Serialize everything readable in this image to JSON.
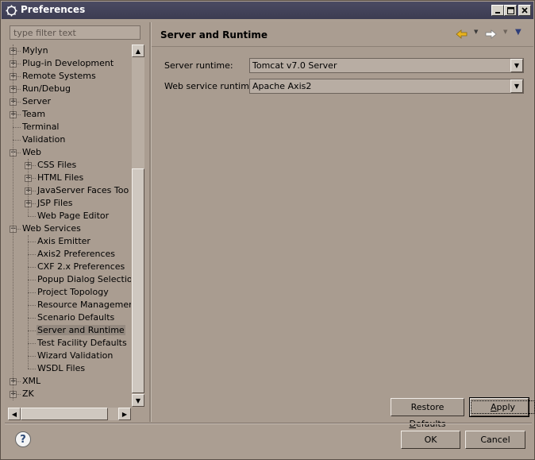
{
  "window": {
    "title": "Preferences"
  },
  "filter": {
    "placeholder": "type filter text"
  },
  "tree": {
    "items": [
      {
        "label": "Mylyn",
        "level": 0,
        "expander": "+"
      },
      {
        "label": "Plug-in Development",
        "level": 0,
        "expander": "+"
      },
      {
        "label": "Remote Systems",
        "level": 0,
        "expander": "+"
      },
      {
        "label": "Run/Debug",
        "level": 0,
        "expander": "+"
      },
      {
        "label": "Server",
        "level": 0,
        "expander": "+"
      },
      {
        "label": "Team",
        "level": 0,
        "expander": "+"
      },
      {
        "label": "Terminal",
        "level": 0,
        "expander": ""
      },
      {
        "label": "Validation",
        "level": 0,
        "expander": ""
      },
      {
        "label": "Web",
        "level": 0,
        "expander": "-"
      },
      {
        "label": "CSS Files",
        "level": 1,
        "expander": "+"
      },
      {
        "label": "HTML Files",
        "level": 1,
        "expander": "+"
      },
      {
        "label": "JavaServer Faces Too",
        "level": 1,
        "expander": "+"
      },
      {
        "label": "JSP Files",
        "level": 1,
        "expander": "+"
      },
      {
        "label": "Web Page Editor",
        "level": 1,
        "expander": ""
      },
      {
        "label": "Web Services",
        "level": 0,
        "expander": "-"
      },
      {
        "label": "Axis Emitter",
        "level": 1,
        "expander": ""
      },
      {
        "label": "Axis2 Preferences",
        "level": 1,
        "expander": ""
      },
      {
        "label": "CXF 2.x Preferences",
        "level": 1,
        "expander": ""
      },
      {
        "label": "Popup Dialog Selection",
        "level": 1,
        "expander": ""
      },
      {
        "label": "Project Topology",
        "level": 1,
        "expander": ""
      },
      {
        "label": "Resource Management",
        "level": 1,
        "expander": ""
      },
      {
        "label": "Scenario Defaults",
        "level": 1,
        "expander": ""
      },
      {
        "label": "Server and Runtime",
        "level": 1,
        "expander": "",
        "selected": true
      },
      {
        "label": "Test Facility Defaults",
        "level": 1,
        "expander": ""
      },
      {
        "label": "Wizard Validation",
        "level": 1,
        "expander": ""
      },
      {
        "label": "WSDL Files",
        "level": 1,
        "expander": ""
      },
      {
        "label": "XML",
        "level": 0,
        "expander": "+"
      },
      {
        "label": "ZK",
        "level": 0,
        "expander": "+"
      }
    ]
  },
  "page": {
    "title": "Server and Runtime",
    "fields": [
      {
        "label": "Server runtime:",
        "value": "Tomcat v7.0 Server"
      },
      {
        "label": "Web service runtime:",
        "value": "Apache Axis2"
      }
    ],
    "restore_defaults": {
      "pre": "Restore ",
      "mnemonic": "D",
      "post": "efaults"
    },
    "apply": {
      "pre": "",
      "mnemonic": "A",
      "post": "pply"
    }
  },
  "footer": {
    "help": "?",
    "ok": "OK",
    "cancel": "Cancel"
  },
  "colors": {
    "background": "#ab9e92",
    "titlebar": "#3c3c52",
    "selection": "#958a80",
    "back_arrow": "#e8b320",
    "forward_arrow": "#ffffff",
    "menu_arrow": "#2e3e7a"
  },
  "icons": [
    "eclipse-icon",
    "minimize-icon",
    "maximize-icon",
    "close-icon",
    "back-arrow-icon",
    "forward-arrow-icon",
    "view-menu-icon",
    "help-icon"
  ]
}
